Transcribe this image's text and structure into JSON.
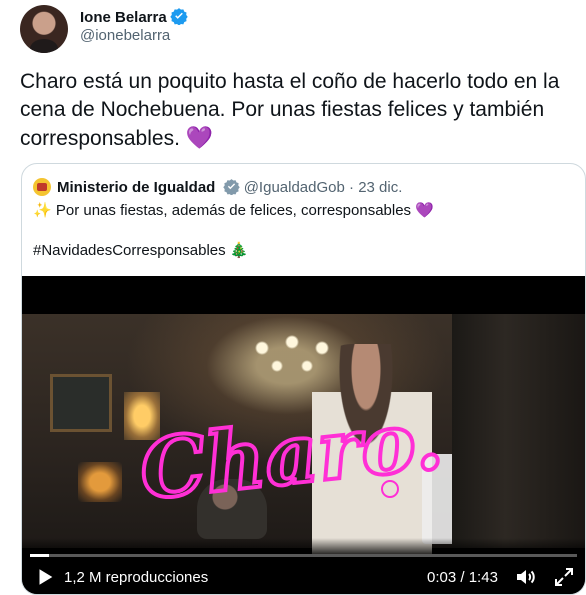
{
  "tweet": {
    "author_name": "Ione Belarra",
    "author_handle": "@ionebelarra",
    "text": "Charo está un poquito hasta el coño de hacerlo todo en la cena de Nochebuena. Por unas fiestas felices y también corresponsables.",
    "emoji_heart": "💜"
  },
  "quoted_tweet": {
    "author_name": "Ministerio de Igualdad",
    "author_handle": "@IgualdadGob",
    "separator": "·",
    "date": "23 dic.",
    "emoji_sparkle": "✨",
    "text": "Por unas fiestas, además de felices, corresponsables",
    "emoji_heart": "💜",
    "hashtag": "#NavidadesCorresponsables",
    "emoji_tree": "🎄"
  },
  "video": {
    "overlay_title": "Charo.",
    "views_label": "1,2 M reproducciones",
    "current_time": "0:03",
    "time_separator": "/",
    "duration": "1:43",
    "progress_fraction": 0.035
  },
  "icons": [
    "avatar",
    "verified-badge-icon",
    "ministry-logo-icon",
    "play-icon",
    "volume-icon",
    "fullscreen-icon"
  ],
  "colors": {
    "verified": "#1d9bf0",
    "overlay_title": "#ff2fd6",
    "border": "#cfd9de",
    "secondary_text": "#536471"
  }
}
